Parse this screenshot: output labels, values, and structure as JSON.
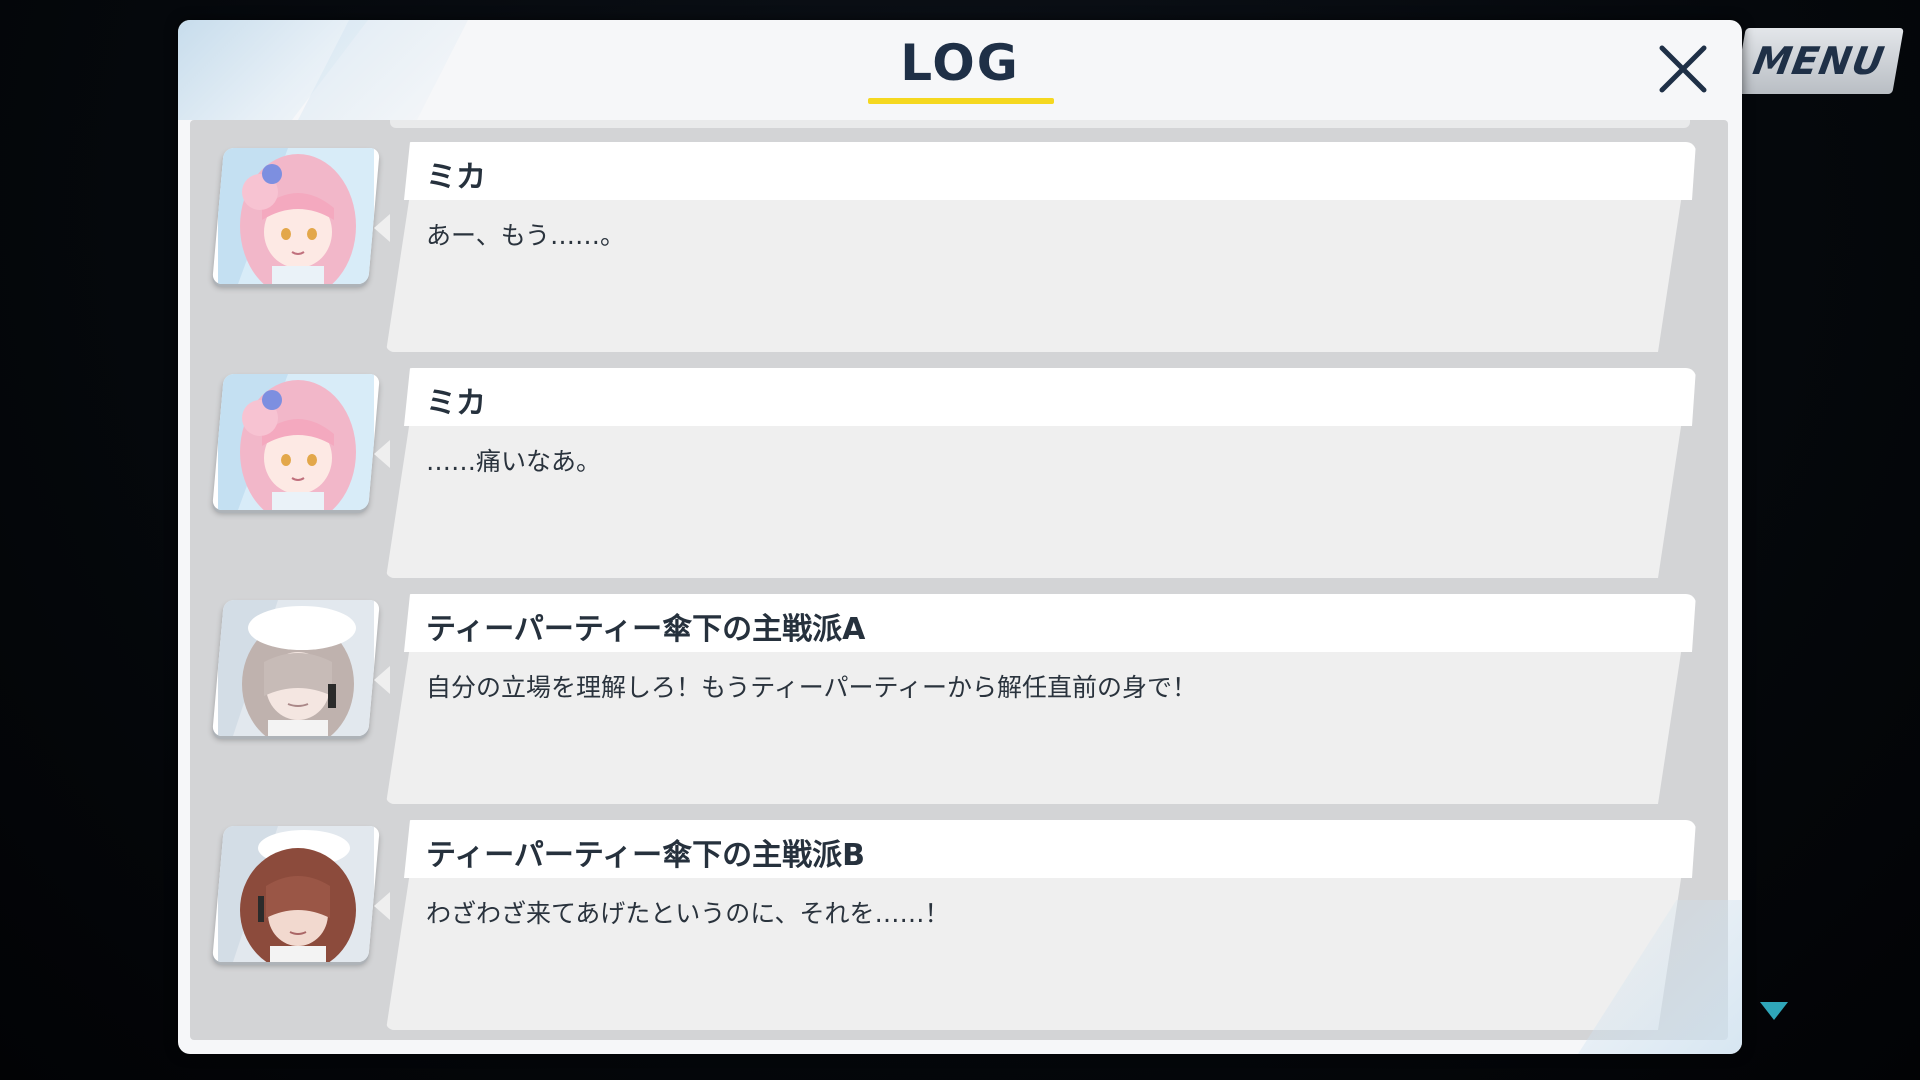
{
  "header": {
    "title": "LOG",
    "close_icon": "close-x-icon",
    "menu_label": "MENU"
  },
  "colors": {
    "title": "#1f3047",
    "underline": "#f5d820",
    "panel": "#f6f7f9",
    "list_bg": "#d3d4d6",
    "scroll_arrow": "#2fa6b9"
  },
  "entries": [
    {
      "speaker": "ミカ",
      "text": "あー、もう……。",
      "avatar": "mika-portrait"
    },
    {
      "speaker": "ミカ",
      "text": "……痛いなあ。",
      "avatar": "mika-portrait"
    },
    {
      "speaker": "ティーパーティー傘下の主戦派A",
      "text": "自分の立場を理解しろ！もうティーパーティーから解任直前の身で！",
      "avatar": "faction-a-portrait"
    },
    {
      "speaker": "ティーパーティー傘下の主戦派B",
      "text": "わざわざ来てあげたというのに、それを……！",
      "avatar": "faction-b-portrait"
    }
  ],
  "scroll_indicator": "scroll-down-arrow-icon"
}
